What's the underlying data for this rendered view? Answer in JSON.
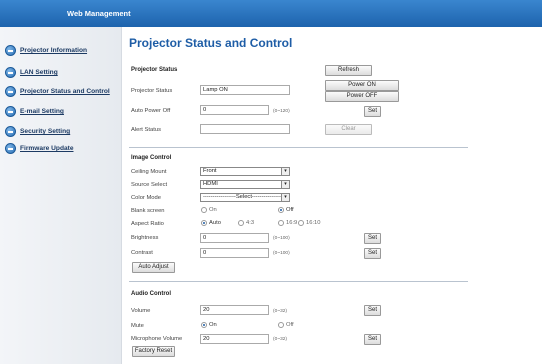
{
  "header": {
    "title": "Web Management"
  },
  "sidebar": {
    "items": [
      {
        "label": "Projector Information"
      },
      {
        "label": "LAN Setting"
      },
      {
        "label": "Projector Status and Control"
      },
      {
        "label": "E-mail Setting"
      },
      {
        "label": "Security Setting"
      },
      {
        "label": "Firmware Update"
      }
    ]
  },
  "page": {
    "title": "Projector Status and Control"
  },
  "status": {
    "section_title": "Projector Status",
    "refresh_label": "Refresh",
    "projector_status_label": "Projector Status",
    "projector_status_value": "Lamp ON",
    "power_on_label": "Power ON",
    "power_off_label": "Power OFF",
    "auto_power_off_label": "Auto Power Off",
    "auto_power_off_value": "0",
    "auto_power_off_range": "(0~120)",
    "set_label": "Set",
    "alert_status_label": "Alert Status",
    "alert_status_value": "",
    "clear_label": "Clear"
  },
  "image": {
    "section_title": "Image Control",
    "ceiling_mount_label": "Ceiling Mount",
    "ceiling_mount_value": "Front",
    "source_select_label": "Source Select",
    "source_select_value": "HDMI",
    "color_mode_label": "Color Mode",
    "color_mode_value": "-----------------Select-----------------",
    "blank_screen_label": "Blank screen",
    "blank_on": "On",
    "blank_off": "Off",
    "aspect_ratio_label": "Aspect Ratio",
    "aspect_auto": "Auto",
    "aspect_43": "4:3",
    "aspect_169": "16:9",
    "aspect_1610": "16:10",
    "brightness_label": "Brightness",
    "brightness_value": "0",
    "brightness_range": "(0~100)",
    "contrast_label": "Contrast",
    "contrast_value": "0",
    "contrast_range": "(0~100)",
    "set_label": "Set",
    "auto_adjust_label": "Auto Adjust"
  },
  "audio": {
    "section_title": "Audio Control",
    "volume_label": "Volume",
    "volume_value": "20",
    "volume_range": "(0~32)",
    "mute_label": "Mute",
    "mute_on": "On",
    "mute_off": "Off",
    "mic_volume_label": "Microphone Volume",
    "mic_volume_value": "20",
    "mic_volume_range": "(0~32)",
    "set_label": "Set",
    "factory_reset_label": "Factory Reset"
  }
}
